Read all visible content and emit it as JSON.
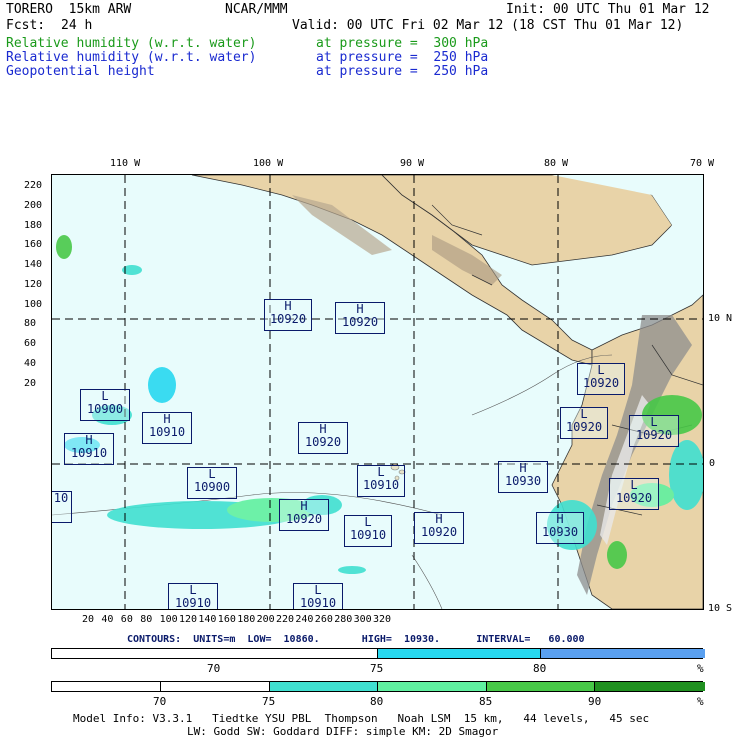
{
  "header": {
    "model": "TORERO  15km ARW",
    "org": "NCAR/MMM",
    "init": "Init: 00 UTC Thu 01 Mar 12",
    "fcst_label": "Fcst:",
    "fcst_value": "24 h",
    "valid": "Valid: 00 UTC Fri 02 Mar 12 (18 CST Thu 01 Mar 12)",
    "fields": [
      {
        "name": "Relative humidity (w.r.t. water)",
        "level": "at pressure =  300 hPa",
        "color": "#1a9a1a"
      },
      {
        "name": "Relative humidity (w.r.t. water)",
        "level": "at pressure =  250 hPa",
        "color": "#1a2ad0"
      },
      {
        "name": "Geopotential height",
        "level": "at pressure =  250 hPa",
        "color": "#1a2ad0"
      }
    ]
  },
  "axes": {
    "top_lon_labels": [
      "110 W",
      "100 W",
      "90 W",
      "80 W",
      "70 W"
    ],
    "right_lat_labels": [
      "10 N",
      "0",
      "10 S"
    ],
    "y_ticks": [
      "220",
      "200",
      "180",
      "160",
      "140",
      "120",
      "100",
      "80",
      "60",
      "40",
      "20"
    ],
    "x_ticks": [
      "20",
      "40",
      "60",
      "80",
      "100",
      "120",
      "140",
      "160",
      "180",
      "200",
      "220",
      "240",
      "260",
      "280",
      "300",
      "320"
    ]
  },
  "centers": [
    {
      "type": "H",
      "value": "10920"
    },
    {
      "type": "H",
      "value": "10920"
    },
    {
      "type": "L",
      "value": "10900"
    },
    {
      "type": "H",
      "value": "10910"
    },
    {
      "type": "H",
      "value": "10910"
    },
    {
      "type": "H",
      "value": "10920"
    },
    {
      "type": "L",
      "value": "10900"
    },
    {
      "type": "L",
      "value": "10910"
    },
    {
      "type": "H",
      "value": "10920"
    },
    {
      "type": "L",
      "value": "10910"
    },
    {
      "type": "H",
      "value": "10920"
    },
    {
      "type": "H",
      "value": "10930"
    },
    {
      "type": "H",
      "value": "10930"
    },
    {
      "type": "L",
      "value": "10920"
    },
    {
      "type": "L",
      "value": "10920"
    },
    {
      "type": "L",
      "value": "10920"
    },
    {
      "type": "L",
      "value": "10920"
    },
    {
      "type": "L",
      "value": "10910"
    },
    {
      "type": "L",
      "value": "10910"
    },
    {
      "type": "",
      "value": "10"
    }
  ],
  "contours": {
    "text": "CONTOURS:  UNITS=m  LOW=  10860.       HIGH=  10930.      INTERVAL=   60.000"
  },
  "legend1": {
    "labels": [
      "70",
      "75",
      "80"
    ],
    "unit": "%",
    "colors": [
      "#ffffff",
      "#28d8f0",
      "#5aa0f0"
    ]
  },
  "legend2": {
    "labels": [
      "70",
      "75",
      "80",
      "85",
      "90"
    ],
    "unit": "%",
    "colors": [
      "#ffffff",
      "#ffffff",
      "#40e0d0",
      "#60f0a0",
      "#48c848",
      "#209020"
    ]
  },
  "footer": {
    "line1": "Model Info: V3.3.1   Tiedtke YSU PBL  Thompson   Noah LSM  15 km,   44 levels,   45 sec",
    "line2": "LW: Godd SW: Goddard DIFF: simple KM: 2D Smagor"
  }
}
